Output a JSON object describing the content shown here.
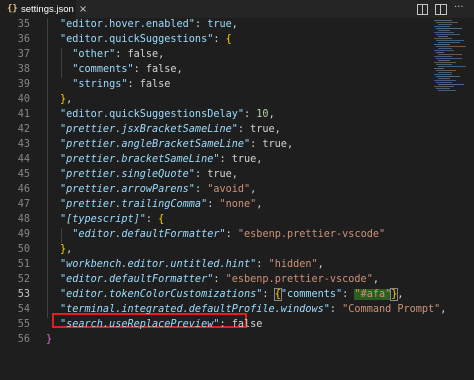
{
  "tab": {
    "icon": "json-braces-icon",
    "icon_glyph": "{}",
    "label": "settings.json",
    "close_glyph": "×"
  },
  "actions": {
    "more_glyph": "···"
  },
  "lines": [
    {
      "num": "35",
      "tokens": [
        {
          "c": "k",
          "t": "\"editor.hover.enabled\""
        },
        {
          "c": "b",
          "t": ": "
        },
        {
          "c": "k",
          "t": "true"
        },
        {
          "c": "b",
          "t": ","
        }
      ]
    },
    {
      "num": "36",
      "tokens": [
        {
          "c": "k",
          "t": "\"editor.quickSuggestions\""
        },
        {
          "c": "b",
          "t": ": "
        },
        {
          "c": "y",
          "t": "{"
        }
      ]
    },
    {
      "num": "37",
      "tokens": [
        {
          "c": "b",
          "t": "  "
        },
        {
          "c": "k",
          "t": "\"other\""
        },
        {
          "c": "b",
          "t": ": false,"
        }
      ]
    },
    {
      "num": "38",
      "tokens": [
        {
          "c": "b",
          "t": "  "
        },
        {
          "c": "k",
          "t": "\"comments\""
        },
        {
          "c": "b",
          "t": ": false,"
        }
      ]
    },
    {
      "num": "39",
      "tokens": [
        {
          "c": "b",
          "t": "  "
        },
        {
          "c": "k",
          "t": "\"strings\""
        },
        {
          "c": "b",
          "t": ": false"
        }
      ]
    },
    {
      "num": "40",
      "tokens": [
        {
          "c": "y",
          "t": "}"
        },
        {
          "c": "b",
          "t": ","
        }
      ]
    },
    {
      "num": "41",
      "tokens": [
        {
          "c": "k",
          "t": "\"editor.quickSuggestionsDelay\""
        },
        {
          "c": "b",
          "t": ": "
        },
        {
          "c": "n",
          "t": "10"
        },
        {
          "c": "b",
          "t": ","
        }
      ]
    },
    {
      "num": "42",
      "tokens": [
        {
          "c": "ki",
          "t": "\"prettier.jsxBracketSameLine\""
        },
        {
          "c": "b",
          "t": ": true,"
        }
      ]
    },
    {
      "num": "43",
      "tokens": [
        {
          "c": "ki",
          "t": "\"prettier.angleBracketSameLine\""
        },
        {
          "c": "b",
          "t": ": true,"
        }
      ]
    },
    {
      "num": "44",
      "tokens": [
        {
          "c": "ki",
          "t": "\"prettier.bracketSameLine\""
        },
        {
          "c": "b",
          "t": ": true,"
        }
      ]
    },
    {
      "num": "45",
      "tokens": [
        {
          "c": "ki",
          "t": "\"prettier.singleQuote\""
        },
        {
          "c": "b",
          "t": ": true,"
        }
      ]
    },
    {
      "num": "46",
      "tokens": [
        {
          "c": "ki",
          "t": "\"prettier.arrowParens\""
        },
        {
          "c": "b",
          "t": ": "
        },
        {
          "c": "s",
          "t": "\"avoid\""
        },
        {
          "c": "b",
          "t": ","
        }
      ]
    },
    {
      "num": "47",
      "tokens": [
        {
          "c": "ki",
          "t": "\"prettier.trailingComma\""
        },
        {
          "c": "b",
          "t": ": "
        },
        {
          "c": "s",
          "t": "\"none\""
        },
        {
          "c": "b",
          "t": ","
        }
      ]
    },
    {
      "num": "48",
      "tokens": [
        {
          "c": "ki",
          "t": "\"[typescript]\""
        },
        {
          "c": "b",
          "t": ": "
        },
        {
          "c": "y",
          "t": "{"
        }
      ]
    },
    {
      "num": "49",
      "tokens": [
        {
          "c": "b",
          "t": "  "
        },
        {
          "c": "ki",
          "t": "\"editor.defaultFormatter\""
        },
        {
          "c": "b",
          "t": ": "
        },
        {
          "c": "s",
          "t": "\"esbenp.prettier-vscode\""
        }
      ]
    },
    {
      "num": "50",
      "tokens": [
        {
          "c": "y",
          "t": "}"
        },
        {
          "c": "b",
          "t": ","
        }
      ]
    },
    {
      "num": "51",
      "tokens": [
        {
          "c": "ki",
          "t": "\"workbench.editor.untitled.hint\""
        },
        {
          "c": "b",
          "t": ": "
        },
        {
          "c": "s",
          "t": "\"hidden\""
        },
        {
          "c": "b",
          "t": ","
        }
      ]
    },
    {
      "num": "52",
      "tokens": [
        {
          "c": "ki",
          "t": "\"editor.defaultFormatter\""
        },
        {
          "c": "b",
          "t": ": "
        },
        {
          "c": "s",
          "t": "\"esbenp.prettier-vscode\""
        },
        {
          "c": "b",
          "t": ","
        }
      ]
    },
    {
      "num": "53",
      "current": true,
      "tokens": [
        {
          "c": "ki",
          "t": "\"editor.tokenColorCustomizations\""
        },
        {
          "c": "b",
          "t": ": "
        },
        {
          "c": "y bra",
          "t": "{"
        },
        {
          "c": "k",
          "t": "\"comments\""
        },
        {
          "c": "b",
          "t": ": "
        },
        {
          "c": "sel",
          "t": "\"#afa\""
        },
        {
          "c": "y bra",
          "t": "}"
        },
        {
          "c": "b",
          "t": ","
        }
      ]
    },
    {
      "num": "54",
      "tokens": [
        {
          "c": "ki",
          "t": "\"terminal.integrated.defaultProfile.windows\""
        },
        {
          "c": "b",
          "t": ": "
        },
        {
          "c": "s",
          "t": "\"Command Prompt\""
        },
        {
          "c": "b",
          "t": ","
        }
      ]
    },
    {
      "num": "55",
      "tokens": [
        {
          "c": "ki",
          "t": "\"search.useReplacePreview\""
        },
        {
          "c": "b",
          "t": ": false"
        }
      ]
    },
    {
      "num": "56",
      "tokens": [
        {
          "c": "m",
          "t": "}"
        }
      ]
    }
  ]
}
